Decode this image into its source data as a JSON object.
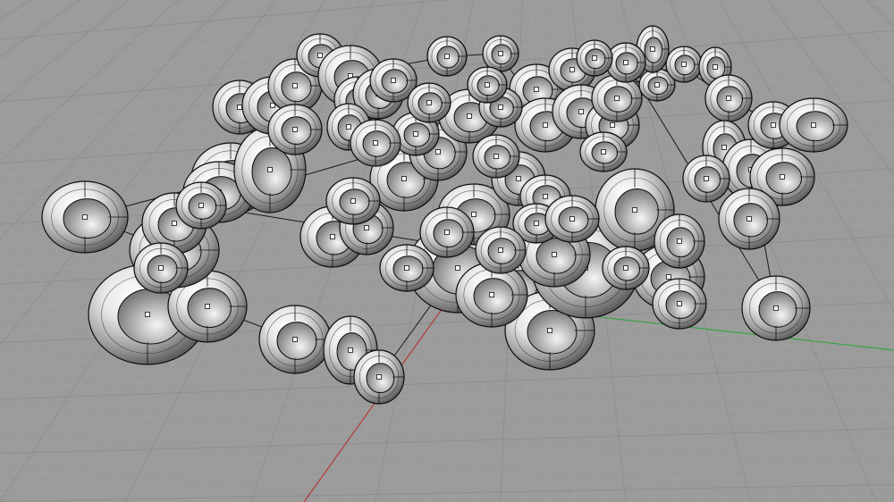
{
  "viewport": {
    "view": "perspective",
    "background_color": "#9b9b9b",
    "grid_minor_color": "#a3a3a3",
    "grid_major_color": "#8d8d8d",
    "x_axis_color": "#b23a3a",
    "y_axis_color": "#3aa346",
    "curve_color": "#1a1a1a",
    "torus_edge_color": "#0d0d0d",
    "torus_count": 78
  }
}
